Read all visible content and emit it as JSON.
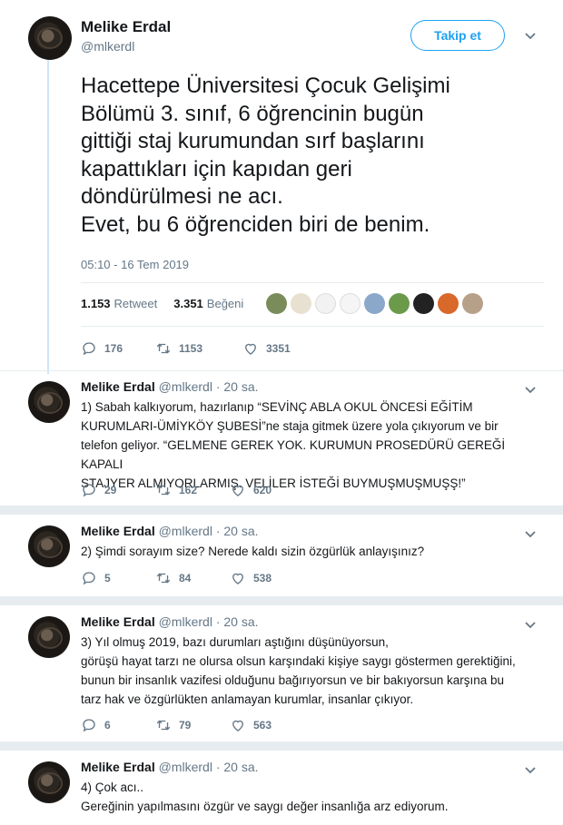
{
  "main_tweet": {
    "author_name": "Melike Erdal",
    "handle": "@mlkerdl",
    "follow_label": "Takip et",
    "text_lines": [
      "Hacettepe Üniversitesi Çocuk Gelişimi",
      "Bölümü 3. sınıf, 6 öğrencinin bugün",
      "gittiği staj kurumundan sırf başlarını",
      "kapattıkları için kapıdan geri",
      "döndürülmesi ne acı.",
      "Evet, bu 6 öğrenciden biri de benim."
    ],
    "timestamp": "05:10 - 16 Tem 2019",
    "retweet_count": "1.153",
    "retweet_label": "Retweet",
    "like_count": "3.351",
    "like_label": "Beğeni",
    "actions": {
      "replies": "176",
      "retweets": "1153",
      "likes": "3351"
    }
  },
  "likers_colors": [
    "#7a8c5a",
    "#e8e0d0",
    "#f2f2f2",
    "#f5f5f5",
    "#8ba7c9",
    "#6b9a4a",
    "#222222",
    "#d9682b",
    "#b7a08a"
  ],
  "replies": [
    {
      "author_name": "Melike Erdal",
      "handle": "@mlkerdl",
      "time": "· 20 sa.",
      "lines": [
        "1) Sabah kalkıyorum, hazırlanıp “SEVİNÇ ABLA OKUL ÖNCESİ EĞİTİM",
        "KURUMLARI-ÜMİYKÖY ŞUBESİ”ne staja gitmek üzere yola çıkıyorum ve bir",
        "telefon geliyor. “GELMENE GEREK YOK. KURUMUN PROSEDÜRÜ GEREĞİ KAPALI",
        "STAJYER ALMIYORLARMIŞ. VELİLER İSTEĞİ BUYMUŞMUŞMUŞŞ!”"
      ],
      "replies": "29",
      "retweets": "162",
      "likes": "620"
    },
    {
      "author_name": "Melike Erdal",
      "handle": "@mlkerdl",
      "time": "· 20 sa.",
      "lines": [
        "2) Şimdi sorayım size? Nerede kaldı sizin özgürlük anlayışınız?"
      ],
      "replies": "5",
      "retweets": "84",
      "likes": "538"
    },
    {
      "author_name": "Melike Erdal",
      "handle": "@mlkerdl",
      "time": "· 20 sa.",
      "lines": [
        "3) Yıl olmuş 2019, bazı durumları aştığını düşünüyorsun,",
        "görüşü hayat tarzı ne olursa olsun karşındaki kişiye saygı göstermen gerektiğini,",
        "bunun bir insanlık vazifesi olduğunu bağırıyorsun ve bir bakıyorsun karşına bu",
        "tarz hak ve özgürlükten anlamayan kurumlar, insanlar çıkıyor."
      ],
      "replies": "6",
      "retweets": "79",
      "likes": "563"
    },
    {
      "author_name": "Melike Erdal",
      "handle": "@mlkerdl",
      "time": "· 20 sa.",
      "lines": [
        "4) Çok acı..",
        "Gereğinin yapılmasını özgür ve saygı değer insanlığa arz ediyorum."
      ]
    }
  ]
}
